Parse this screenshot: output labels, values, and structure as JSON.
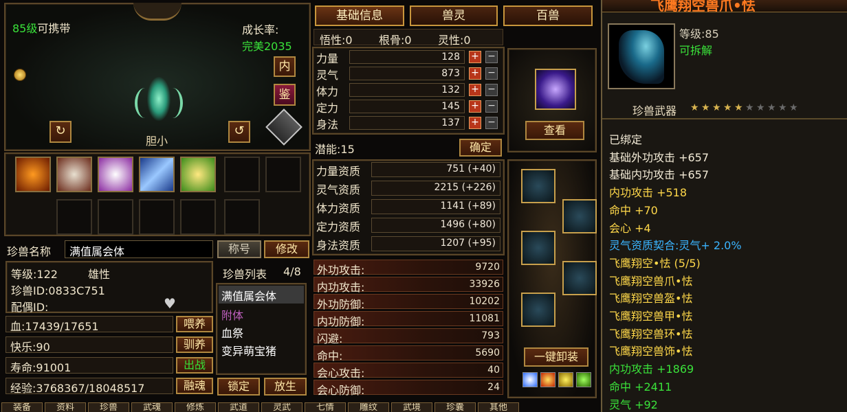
{
  "pet_view": {
    "level_label": "85级",
    "carry_label": "可携带",
    "growth_label": "成长率:",
    "growth_value": "完美2035",
    "temperament": "胆小",
    "btn_inner": "内",
    "btn_appraise": "鉴"
  },
  "pet_info": {
    "name_label": "珍兽名称",
    "name_value": "满值属会体",
    "title_btn": "称号",
    "modify_btn": "修改",
    "level": "等级:122",
    "gender": "雄性",
    "pet_id": "珍兽ID:0833C751",
    "mate_id": "配偶ID:",
    "list_label": "珍兽列表",
    "list_count": "4/8",
    "hp": "血:17439/17651",
    "happy": "快乐:90",
    "life": "寿命:91001",
    "exp": "经验:3768367/18048517",
    "feed_btn": "喂养",
    "tame_btn": "驯养",
    "battle_btn": "出战",
    "fuse_btn": "融魂",
    "lock_btn": "锁定",
    "release_btn": "放生"
  },
  "pet_list": [
    "满值属会体",
    "附体",
    "血祭",
    "变异萌宝猪"
  ],
  "tabs": [
    "基础信息",
    "兽灵",
    "百兽"
  ],
  "attrs_header": {
    "wuxing": "悟性:0",
    "gengu": "根骨:0",
    "lingxing": "灵性:0"
  },
  "attributes": [
    {
      "label": "力量",
      "value": "128"
    },
    {
      "label": "灵气",
      "value": "873"
    },
    {
      "label": "体力",
      "value": "132"
    },
    {
      "label": "定力",
      "value": "145"
    },
    {
      "label": "身法",
      "value": "137"
    }
  ],
  "potential": "潜能:15",
  "confirm_btn": "确定",
  "aptitudes": [
    {
      "label": "力量资质",
      "value": "751 (+40)"
    },
    {
      "label": "灵气资质",
      "value": "2215 (+226)"
    },
    {
      "label": "体力资质",
      "value": "1141 (+89)"
    },
    {
      "label": "定力资质",
      "value": "1496 (+80)"
    },
    {
      "label": "身法资质",
      "value": "1207 (+95)"
    }
  ],
  "combat": [
    {
      "label": "外功攻击:",
      "value": "9720"
    },
    {
      "label": "内功攻击:",
      "value": "33926"
    },
    {
      "label": "外功防御:",
      "value": "10202"
    },
    {
      "label": "内功防御:",
      "value": "11081"
    },
    {
      "label": "闪避:",
      "value": "793"
    },
    {
      "label": "命中:",
      "value": "5690"
    },
    {
      "label": "会心攻击:",
      "value": "40"
    },
    {
      "label": "会心防御:",
      "value": "24"
    }
  ],
  "view_btn": "查看",
  "unequip_btn": "一键卸装",
  "bottom_tabs": [
    "装备",
    "资料",
    "珍兽",
    "武魂",
    "修炼",
    "武道",
    "灵武",
    "七情",
    "雕纹",
    "武境",
    "珍囊",
    "其他"
  ],
  "tooltip": {
    "title": "飞鹰翔空兽爪•怯",
    "level": "等级:85",
    "dismantle": "可拆解",
    "category": "珍兽武器",
    "stars_filled": 5,
    "stars_total": 10,
    "lines": [
      {
        "text": "已绑定",
        "color": "#f2ead6"
      },
      {
        "text": "基础外功攻击 +657",
        "color": "#f2ead6"
      },
      {
        "text": "基础内功攻击 +657",
        "color": "#f2ead6"
      },
      {
        "text": "内功攻击 +518",
        "color": "#ffd84a"
      },
      {
        "text": "命中 +70",
        "color": "#ffd84a"
      },
      {
        "text": "会心 +4",
        "color": "#ffd84a"
      },
      {
        "text": "灵气资质契合:灵气+ 2.0%",
        "color": "#3ab4ff"
      },
      {
        "text": "飞鹰翔空•怯 (5/5)",
        "color": "#ffd84a"
      },
      {
        "text": "飞鹰翔空兽爪•怯",
        "color": "#ffd84a"
      },
      {
        "text": "飞鹰翔空兽盔•怯",
        "color": "#ffd84a"
      },
      {
        "text": "飞鹰翔空兽甲•怯",
        "color": "#ffd84a"
      },
      {
        "text": "飞鹰翔空兽环•怯",
        "color": "#ffd84a"
      },
      {
        "text": "飞鹰翔空兽饰•怯",
        "color": "#ffd84a"
      },
      {
        "text": "内功攻击 +1869",
        "color": "#3ae23a"
      },
      {
        "text": "命中 +2411",
        "color": "#3ae23a"
      },
      {
        "text": "灵气 +92",
        "color": "#3ae23a"
      }
    ]
  },
  "colors": {
    "gold": "#c8963c",
    "green": "#3ae23a",
    "yellow": "#ffd84a",
    "cyan": "#3ab4ff",
    "bg": "#14110d"
  }
}
